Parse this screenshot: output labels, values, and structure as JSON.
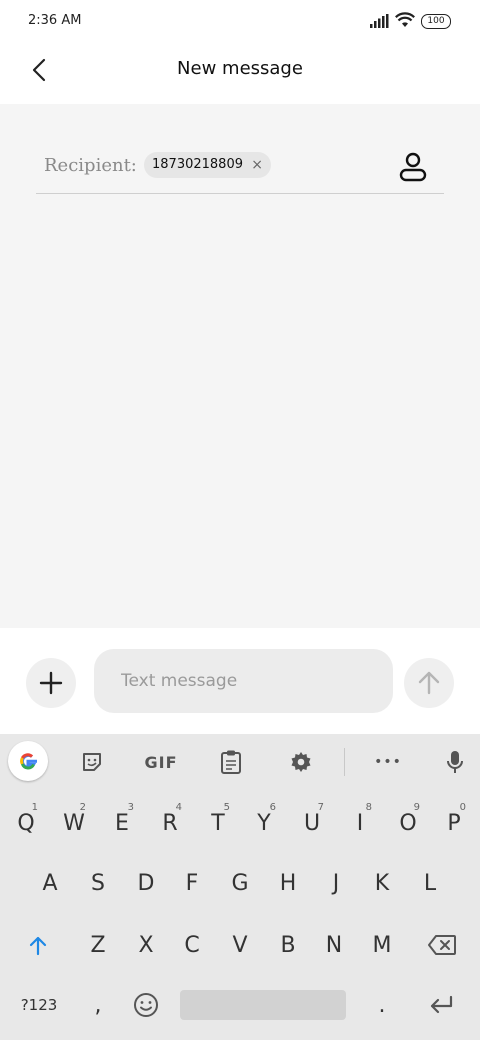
{
  "status_bar": {
    "time": "2:36 AM",
    "battery": "100"
  },
  "header": {
    "title": "New message"
  },
  "recipient": {
    "label": "Recipient:",
    "chip_value": "18730218809",
    "chip_remove": "×"
  },
  "compose": {
    "placeholder": "Text message"
  },
  "keyboard": {
    "toolbar": {
      "gif_label": "GIF",
      "more": "•••"
    },
    "row1": [
      {
        "key": "Q",
        "hint": "1"
      },
      {
        "key": "W",
        "hint": "2"
      },
      {
        "key": "E",
        "hint": "3"
      },
      {
        "key": "R",
        "hint": "4"
      },
      {
        "key": "T",
        "hint": "5"
      },
      {
        "key": "Y",
        "hint": "6"
      },
      {
        "key": "U",
        "hint": "7"
      },
      {
        "key": "I",
        "hint": "8"
      },
      {
        "key": "O",
        "hint": "9"
      },
      {
        "key": "P",
        "hint": "0"
      }
    ],
    "row2": [
      "A",
      "S",
      "D",
      "F",
      "G",
      "H",
      "J",
      "K",
      "L"
    ],
    "row3": [
      "Z",
      "X",
      "C",
      "V",
      "B",
      "N",
      "M"
    ],
    "row4": {
      "symbols": "?123",
      "comma": ",",
      "period": "."
    }
  },
  "colors": {
    "accent_shift": "#1e88e5",
    "content_bg": "#f5f5f5",
    "keyboard_bg": "#e8e8e8"
  }
}
